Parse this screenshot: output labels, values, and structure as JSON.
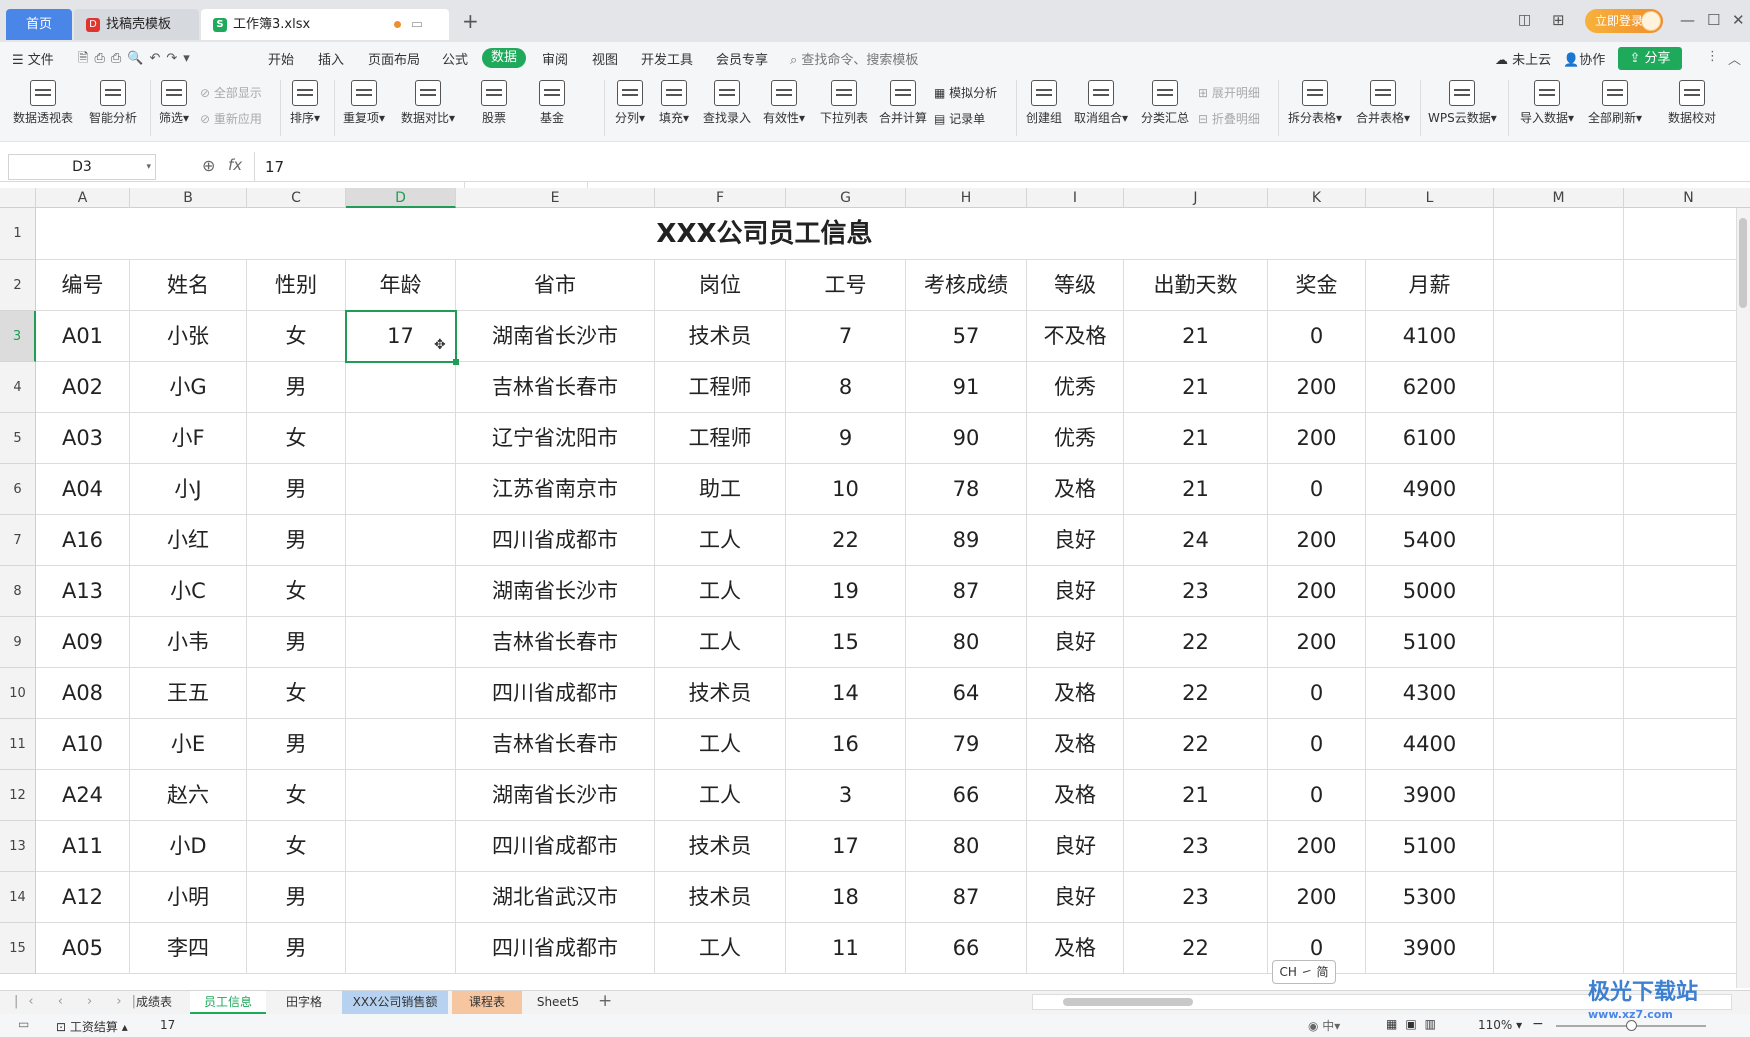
{
  "tabs": {
    "home": "首页",
    "template": "找稿壳模板",
    "file": "工作簿3.xlsx",
    "login": "立即登录"
  },
  "menus": {
    "file": "文件",
    "items": [
      "开始",
      "插入",
      "页面布局",
      "公式",
      "数据",
      "审阅",
      "视图",
      "开发工具",
      "会员专享"
    ],
    "search": "查找命令、搜索模板",
    "cloud": "未上云",
    "collab": "协作",
    "share": "分享"
  },
  "ribbon": {
    "pivot": "数据透视表",
    "smart": "智能分析",
    "filter": "筛选",
    "showall": "全部显示",
    "reapply": "重新应用",
    "sort": "排序",
    "dup": "重复项",
    "compare": "数据对比",
    "stock": "股票",
    "fund": "基金",
    "split": "分列",
    "fill": "填充",
    "lookup": "查找录入",
    "valid": "有效性",
    "dropdown": "下拉列表",
    "consolidate": "合并计算",
    "simulate": "模拟分析",
    "record": "记录单",
    "group": "创建组",
    "ungroup": "取消组合",
    "subtotal": "分类汇总",
    "expand": "展开明细",
    "collapse": "折叠明细",
    "splittable": "拆分表格",
    "mergetable": "合并表格",
    "wpscloud": "WPS云数据",
    "import": "导入数据",
    "refresh": "全部刷新",
    "check": "数据校对"
  },
  "formula": {
    "cell": "D3",
    "fx": "fx",
    "value": "17"
  },
  "columns": [
    "A",
    "B",
    "C",
    "D",
    "E",
    "F",
    "G",
    "H",
    "I",
    "J",
    "K",
    "L",
    "M",
    "N"
  ],
  "rows": [
    "1",
    "2",
    "3",
    "4",
    "5",
    "6",
    "7",
    "8",
    "9",
    "10",
    "11",
    "12",
    "13",
    "14",
    "15"
  ],
  "title": "XXX公司员工信息",
  "headers": [
    "编号",
    "姓名",
    "性别",
    "年龄",
    "省市",
    "岗位",
    "工号",
    "考核成绩",
    "等级",
    "出勤天数",
    "奖金",
    "月薪"
  ],
  "data": [
    [
      "A01",
      "小张",
      "女",
      "17",
      "湖南省长沙市",
      "技术员",
      "7",
      "57",
      "不及格",
      "21",
      "0",
      "4100"
    ],
    [
      "A02",
      "小G",
      "男",
      "",
      "吉林省长春市",
      "工程师",
      "8",
      "91",
      "优秀",
      "21",
      "200",
      "6200"
    ],
    [
      "A03",
      "小F",
      "女",
      "",
      "辽宁省沈阳市",
      "工程师",
      "9",
      "90",
      "优秀",
      "21",
      "200",
      "6100"
    ],
    [
      "A04",
      "小J",
      "男",
      "",
      "江苏省南京市",
      "助工",
      "10",
      "78",
      "及格",
      "21",
      "0",
      "4900"
    ],
    [
      "A16",
      "小红",
      "男",
      "",
      "四川省成都市",
      "工人",
      "22",
      "89",
      "良好",
      "24",
      "200",
      "5400"
    ],
    [
      "A13",
      "小C",
      "女",
      "",
      "湖南省长沙市",
      "工人",
      "19",
      "87",
      "良好",
      "23",
      "200",
      "5000"
    ],
    [
      "A09",
      "小韦",
      "男",
      "",
      "吉林省长春市",
      "工人",
      "15",
      "80",
      "良好",
      "22",
      "200",
      "5100"
    ],
    [
      "A08",
      "王五",
      "女",
      "",
      "四川省成都市",
      "技术员",
      "14",
      "64",
      "及格",
      "22",
      "0",
      "4300"
    ],
    [
      "A10",
      "小E",
      "男",
      "",
      "吉林省长春市",
      "工人",
      "16",
      "79",
      "及格",
      "22",
      "0",
      "4400"
    ],
    [
      "A24",
      "赵六",
      "女",
      "",
      "湖南省长沙市",
      "工人",
      "3",
      "66",
      "及格",
      "21",
      "0",
      "3900"
    ],
    [
      "A11",
      "小D",
      "女",
      "",
      "四川省成都市",
      "技术员",
      "17",
      "80",
      "良好",
      "23",
      "200",
      "5100"
    ],
    [
      "A12",
      "小明",
      "男",
      "",
      "湖北省武汉市",
      "技术员",
      "18",
      "87",
      "良好",
      "23",
      "200",
      "5300"
    ],
    [
      "A05",
      "李四",
      "男",
      "",
      "四川省成都市",
      "工人",
      "11",
      "66",
      "及格",
      "22",
      "0",
      "3900"
    ]
  ],
  "sheets": [
    "成绩表",
    "员工信息",
    "田字格",
    "XXX公司销售额",
    "课程表",
    "Sheet5"
  ],
  "status": {
    "mode": "工资结算",
    "value": "17",
    "zoom": "110%",
    "ime": "CH ㇀ 简",
    "watermark": "极光下载站",
    "watermark_url": "www.xz7.com"
  },
  "colors": {
    "accent": "#1fa95b",
    "selection": "#1f9d55",
    "home_tab": "#4a86e8",
    "sheet_active": "#1fa95b",
    "sheet_sales_bg": "#b7d2f0",
    "sheet_course_bg": "#f6c6a0"
  }
}
